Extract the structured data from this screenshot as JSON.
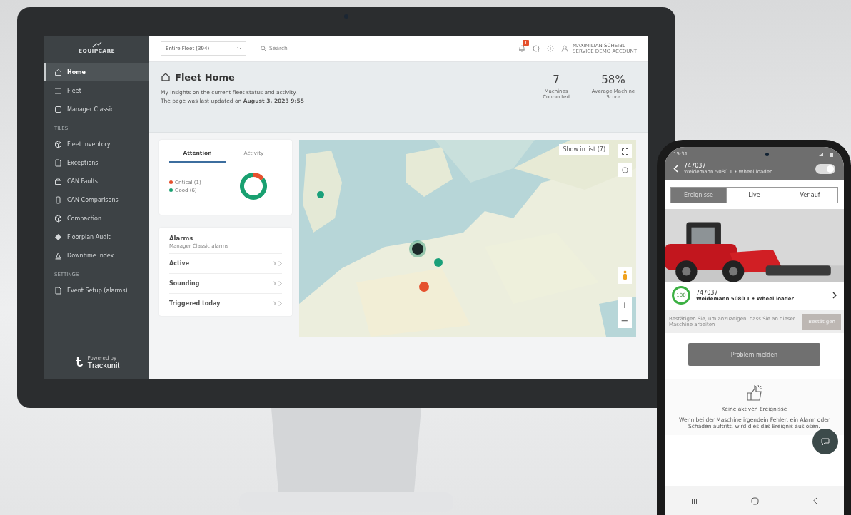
{
  "monitor": {
    "sidebar": {
      "logo": "EQUIPCARE",
      "items": [
        {
          "label": "Home",
          "selected": true
        },
        {
          "label": "Fleet",
          "selected": false
        },
        {
          "label": "Manager Classic",
          "selected": false
        }
      ],
      "sections": [
        {
          "title": "TILES",
          "items": [
            {
              "label": "Fleet Inventory",
              "selected": false
            },
            {
              "label": "Exceptions",
              "selected": false
            },
            {
              "label": "CAN Faults",
              "selected": false
            },
            {
              "label": "CAN Comparisons",
              "selected": false
            },
            {
              "label": "Compaction",
              "selected": false
            },
            {
              "label": "Floorplan Audit",
              "selected": false
            },
            {
              "label": "Downtime Index",
              "selected": false
            }
          ]
        },
        {
          "title": "SETTINGS",
          "items": [
            {
              "label": "Event Setup (alarms)",
              "selected": false
            }
          ]
        }
      ],
      "powered_by": "Powered by",
      "brand": "Trackunit"
    },
    "topbar": {
      "fleet_select": "Entire Fleet (394)",
      "search": {
        "placeholder": "Search"
      },
      "notification_count": "1",
      "user_name": "MAXIMILIAN SCHEIBL",
      "user_role": "SERVICE DEMO ACCOUNT"
    },
    "header": {
      "title": "Fleet Home",
      "lines": [
        "My insights on the current fleet status and activity.",
        "The page was last updated on **August 3, 2023 9:55**"
      ],
      "stats": [
        {
          "value": "7",
          "label": "Machines Connected"
        },
        {
          "value": "58%",
          "label": "Average Machine Score"
        }
      ]
    },
    "attention_card": {
      "tabs": [
        {
          "label": "Attention",
          "selected": true
        },
        {
          "label": "Activity",
          "selected": false
        }
      ],
      "legend": [
        {
          "label": "Critical (1)",
          "color": "#e5512e"
        },
        {
          "label": "Good (6)",
          "color": "#18a070"
        }
      ],
      "chart_data": {
        "type": "donut",
        "values": [
          14.3,
          85.7
        ]
      }
    },
    "alarms": {
      "title": "Alarms",
      "subtitle": "Manager Classic alarms",
      "rows": [
        {
          "label": "Active",
          "count": "0"
        },
        {
          "label": "Sounding",
          "count": "0"
        },
        {
          "label": "Triggered today",
          "count": "0"
        }
      ]
    },
    "map": {
      "show_in_list": "Show in list (7)",
      "zoom_in": "+",
      "zoom_out": "−"
    }
  },
  "phone": {
    "status_time": "15:31",
    "title": "747037",
    "subtitle": "Weidemann 5080 T • Wheel loader",
    "toggle_on": true,
    "tabs": [
      {
        "label": "Ereignisse",
        "selected": true
      },
      {
        "label": "Live",
        "selected": false
      },
      {
        "label": "Verlauf",
        "selected": false
      }
    ],
    "machine": {
      "score": "100",
      "title": "747037",
      "subtitle": "Weidemann 5080 T • Wheel loader"
    },
    "confirm": {
      "text": "Bestätigen Sie, um anzuzeigen, dass Sie an dieser Maschine arbeiten",
      "button": "Bestätigen"
    },
    "report_button": "Problem melden",
    "empty_title": "Keine aktiven Ereignisse",
    "empty_text": "Wenn bei der Maschine irgendein Fehler, ein Alarm oder Schaden auftritt, wird dies das Ereignis auslösen."
  }
}
